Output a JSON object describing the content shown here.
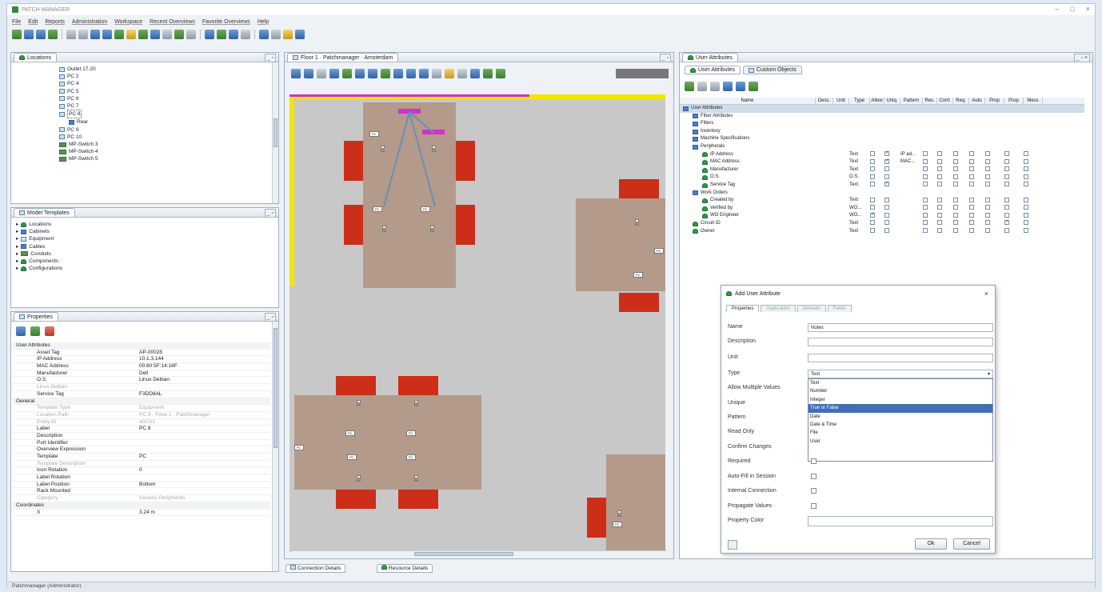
{
  "app": {
    "title": "PATCH MANAGER"
  },
  "menu": [
    "File",
    "Edit",
    "Reports",
    "Administration",
    "Workspace",
    "Recent Overviews",
    "Favorite Overviews",
    "Help"
  ],
  "locations": {
    "tab": "Locations",
    "items": [
      "Outlet 17-20",
      "PC 2",
      "PC 4",
      "PC 5",
      "PC 6",
      "PC 7",
      "PC 8",
      "Rear",
      "PC 9",
      "PC 10",
      "MP-Switch 3",
      "MP-Switch 4",
      "MP-Switch 5"
    ]
  },
  "templates": {
    "tab": "Model Templates",
    "items": [
      "Locations",
      "Cabinets",
      "Equipment",
      "Cables",
      "Conduits",
      "Components",
      "Configurations"
    ]
  },
  "properties": {
    "tab": "Properties",
    "rows": [
      {
        "k": "User Attributes",
        "v": "",
        "t": "grp"
      },
      {
        "k": "Asset Tag",
        "v": "AP-00028",
        "t": ""
      },
      {
        "k": "IP Address",
        "v": "10.1.3.144",
        "t": ""
      },
      {
        "k": "MAC Address",
        "v": "00:80:5F:14:16F",
        "t": ""
      },
      {
        "k": "Manufacturer",
        "v": "Dell",
        "t": ""
      },
      {
        "k": "O.S.",
        "v": "Linux Debian",
        "t": ""
      },
      {
        "k": "Linux Debian",
        "v": "",
        "t": "dim"
      },
      {
        "k": "Service Tag",
        "v": "F3DD8AL",
        "t": ""
      },
      {
        "k": "General",
        "v": "",
        "t": "grp"
      },
      {
        "k": "Template Type",
        "v": "Equipment",
        "t": "dim"
      },
      {
        "k": "Location Path",
        "v": "PC 8 - Floor 1 - Patchmanager",
        "t": "dim"
      },
      {
        "k": "Entity ID",
        "v": "40/251",
        "t": "dim"
      },
      {
        "k": "Label",
        "v": "PC 8",
        "t": ""
      },
      {
        "k": "Description",
        "v": "",
        "t": ""
      },
      {
        "k": "Port Identifier",
        "v": "",
        "t": ""
      },
      {
        "k": "Overview Expression",
        "v": "",
        "t": ""
      },
      {
        "k": "Template",
        "v": "PC",
        "t": ""
      },
      {
        "k": "Template Description",
        "v": "",
        "t": "dim"
      },
      {
        "k": "Icon Rotation",
        "v": "0",
        "t": ""
      },
      {
        "k": "Label Rotation",
        "v": "",
        "t": ""
      },
      {
        "k": "Label Position",
        "v": "Bottom",
        "t": ""
      },
      {
        "k": "Rack Mounted",
        "v": "",
        "t": ""
      },
      {
        "k": "Category",
        "v": "Generic Peripherals",
        "t": "dim"
      },
      {
        "k": "Coordinates",
        "v": "",
        "t": "grp"
      },
      {
        "k": "X",
        "v": "3.24 m",
        "t": ""
      }
    ]
  },
  "floor": {
    "tab": "Floor 1 · Patchmanager · Amsterdam"
  },
  "attributes": {
    "tab": "User Attributes",
    "subtabs": [
      "User Attributes",
      "Custom Objects"
    ],
    "columns": [
      "Name",
      "Desc.",
      "Unit",
      "Type",
      "Allow",
      "Uniq.",
      "Pattern",
      "Res.",
      "Conf.",
      "Req.",
      "Auto",
      "Prop",
      "Prop",
      "Mess"
    ],
    "rows": [
      {
        "name": "User Attributes",
        "ind": 0,
        "type": "",
        "pat": "",
        "c": [],
        "sel": true
      },
      {
        "name": "Fiber Attributes",
        "ind": 1,
        "type": "",
        "pat": "",
        "c": []
      },
      {
        "name": "Filters",
        "ind": 1,
        "type": "",
        "pat": "",
        "c": []
      },
      {
        "name": "Inventory",
        "ind": 1,
        "type": "",
        "pat": "",
        "c": []
      },
      {
        "name": "Machine Specifications",
        "ind": 1,
        "type": "",
        "pat": "",
        "c": []
      },
      {
        "name": "Peripherals",
        "ind": 1,
        "type": "",
        "pat": "",
        "c": []
      },
      {
        "name": "IP Address",
        "ind": 2,
        "type": "Text",
        "pat": "IP ad...",
        "c": [
          0,
          1,
          0,
          0,
          0,
          0,
          0,
          0,
          0,
          0
        ]
      },
      {
        "name": "MAC Address",
        "ind": 2,
        "type": "Text",
        "pat": "MAC...",
        "c": [
          0,
          1,
          0,
          0,
          0,
          0,
          0,
          0,
          0,
          0
        ]
      },
      {
        "name": "Manufacturer",
        "ind": 2,
        "type": "Text",
        "pat": "",
        "c": [
          0,
          0,
          0,
          0,
          0,
          0,
          0,
          0,
          0,
          0
        ]
      },
      {
        "name": "O.S.",
        "ind": 2,
        "type": "O.S.",
        "pat": "",
        "c": [
          0,
          0,
          0,
          0,
          0,
          0,
          0,
          0,
          0,
          0
        ]
      },
      {
        "name": "Service Tag",
        "ind": 2,
        "type": "Text",
        "pat": "",
        "c": [
          0,
          1,
          0,
          0,
          0,
          0,
          0,
          0,
          0,
          0
        ]
      },
      {
        "name": "Work Orders",
        "ind": 1,
        "type": "",
        "pat": "",
        "c": []
      },
      {
        "name": "Created by",
        "ind": 2,
        "type": "Text",
        "pat": "",
        "c": [
          0,
          0,
          0,
          0,
          0,
          0,
          0,
          0,
          0,
          0
        ]
      },
      {
        "name": "Verified by",
        "ind": 2,
        "type": "WO...",
        "pat": "",
        "c": [
          0,
          0,
          0,
          0,
          0,
          0,
          0,
          0,
          0,
          0
        ]
      },
      {
        "name": "WO Engineer",
        "ind": 2,
        "type": "WO...",
        "pat": "",
        "c": [
          1,
          0,
          0,
          0,
          0,
          0,
          0,
          0,
          0,
          0
        ]
      },
      {
        "name": "Circuit ID",
        "ind": 1,
        "type": "Text",
        "pat": "",
        "c": [
          0,
          0,
          0,
          0,
          0,
          0,
          0,
          1,
          0,
          0
        ]
      },
      {
        "name": "Owner",
        "ind": 1,
        "type": "Text",
        "pat": "",
        "c": [
          0,
          0,
          0,
          0,
          0,
          0,
          0,
          0,
          0,
          0
        ]
      }
    ]
  },
  "dialog": {
    "title": "Add User Attribute",
    "tabs": [
      "Properties",
      "Application",
      "Defaults",
      "Fields"
    ],
    "labels": [
      "Name",
      "Description",
      "Unit",
      "Type",
      "Allow Multiple Values",
      "Unique",
      "Pattern",
      "Read Only",
      "Confirm Changes",
      "Required",
      "Auto-Fill in Session",
      "Internal Connection",
      "Propagate Values",
      "Property Color"
    ],
    "name_value": "Notes",
    "type_value": "Text",
    "type_options": [
      "Text",
      "Number",
      "Integer",
      "True or False",
      "Date",
      "Date & Time",
      "File",
      "User"
    ],
    "selected_option": "True or False",
    "ok": "Ok",
    "cancel": "Cancel"
  },
  "bottom_tabs": [
    "Connection Details",
    "Resource Details"
  ],
  "status": "Patchmanager (Administrator)"
}
